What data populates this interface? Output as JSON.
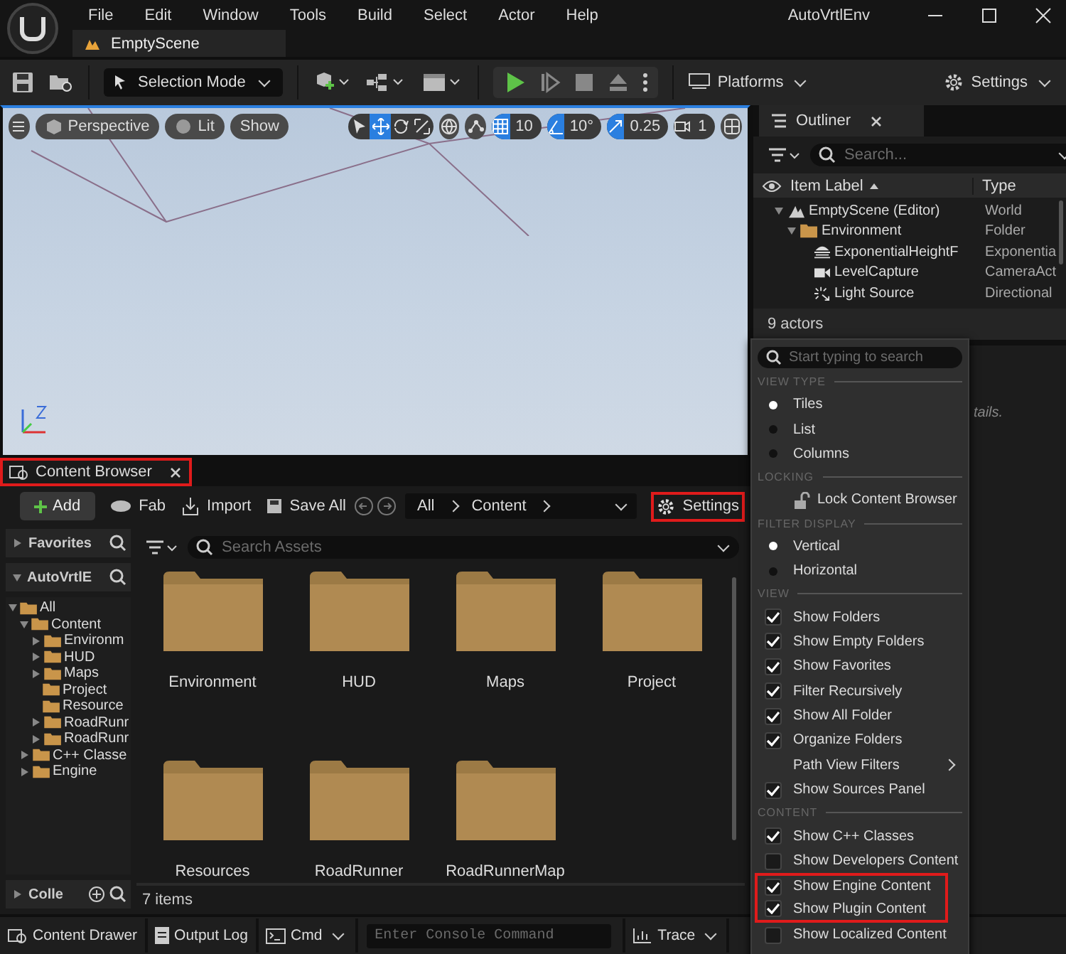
{
  "title_bar": {
    "menu": [
      "File",
      "Edit",
      "Window",
      "Tools",
      "Build",
      "Select",
      "Actor",
      "Help"
    ],
    "project": "AutoVrtlEnv",
    "tab": "EmptyScene"
  },
  "toolbar": {
    "mode": "Selection Mode",
    "platforms": "Platforms",
    "settings": "Settings"
  },
  "viewport": {
    "buttons": [
      {
        "kind": "view",
        "label": "Perspective"
      },
      {
        "kind": "lit",
        "label": "Lit"
      },
      {
        "kind": "plain",
        "label": "Show"
      }
    ],
    "tools": [
      {
        "kind": "select",
        "selected": false
      },
      {
        "kind": "move",
        "selected": true
      },
      {
        "kind": "rotate",
        "selected": false
      },
      {
        "kind": "scale",
        "selected": false
      }
    ],
    "snaps": [
      {
        "kind": "grid",
        "value": "10",
        "on": true
      },
      {
        "kind": "angle",
        "value": "10°",
        "on": true
      },
      {
        "kind": "scale",
        "value": "0.25",
        "on": true
      },
      {
        "kind": "camera",
        "value": "1",
        "on": false
      }
    ]
  },
  "outliner": {
    "title": "Outliner",
    "search": {
      "placeholder": "Search..."
    },
    "columns": [
      "Item Label",
      "Type"
    ],
    "rows": [
      {
        "label": "EmptyScene (Editor)",
        "type": "World",
        "kind": "world",
        "expanded": true,
        "children": [
          {
            "label": "Environment",
            "type": "Folder",
            "kind": "folder",
            "expanded": true,
            "children": [
              {
                "label": "ExponentialHeightF",
                "type": "Exponentia",
                "kind": "fog"
              },
              {
                "label": "LevelCapture",
                "type": "CameraAct",
                "kind": "camera"
              },
              {
                "label": "Light Source",
                "type": "Directional",
                "kind": "light"
              }
            ]
          }
        ]
      }
    ],
    "count": "9 actors"
  },
  "details": {
    "text": "tails."
  },
  "content_browser": {
    "tab": {
      "label": "Content Browser",
      "highlighted": true
    },
    "add": "Add",
    "fab": "Fab",
    "import": "Import",
    "save_all": "Save All",
    "path": [
      "All",
      "Content"
    ],
    "settings": {
      "label": "Settings",
      "highlighted": true
    },
    "sources": {
      "favorites": "Favorites",
      "project": "AutoVrtlE",
      "collections": "Colle",
      "tree": [
        {
          "label": "All",
          "expandable": true,
          "expanded": true,
          "children": [
            {
              "label": "Content",
              "expandable": true,
              "expanded": true,
              "children": [
                {
                  "label": "Environm",
                  "expandable": true,
                  "expanded": false
                },
                {
                  "label": "HUD",
                  "expandable": true,
                  "expanded": false
                },
                {
                  "label": "Maps",
                  "expandable": true,
                  "expanded": false
                },
                {
                  "label": "Project",
                  "expandable": false
                },
                {
                  "label": "Resource",
                  "expandable": false
                },
                {
                  "label": "RoadRunr",
                  "expandable": true,
                  "expanded": false
                },
                {
                  "label": "RoadRunr",
                  "expandable": true,
                  "expanded": false
                }
              ]
            },
            {
              "label": "C++ Classe",
              "expandable": true,
              "expanded": false
            },
            {
              "label": "Engine",
              "expandable": true,
              "expanded": false
            }
          ]
        }
      ]
    },
    "search": {
      "placeholder": "Search Assets"
    },
    "folders": [
      "Environment",
      "HUD",
      "Maps",
      "Project",
      "Resources",
      "RoadRunner",
      "RoadRunnerMap"
    ],
    "count": "7 items"
  },
  "settings_menu": {
    "search": {
      "placeholder": "Start typing to search"
    },
    "sections": [
      {
        "heading": "VIEW TYPE",
        "items": [
          {
            "kind": "radio",
            "label": "Tiles",
            "selected": true
          },
          {
            "kind": "radio",
            "label": "List",
            "selected": false
          },
          {
            "kind": "radio",
            "label": "Columns",
            "selected": false
          }
        ]
      },
      {
        "heading": "LOCKING",
        "items": [
          {
            "kind": "lock",
            "label": "Lock Content Browser"
          }
        ]
      },
      {
        "heading": "FILTER DISPLAY",
        "items": [
          {
            "kind": "radio",
            "label": "Vertical",
            "selected": true
          },
          {
            "kind": "radio",
            "label": "Horizontal",
            "selected": false
          }
        ]
      },
      {
        "heading": "VIEW",
        "items": [
          {
            "kind": "check",
            "label": "Show Folders",
            "checked": true
          },
          {
            "kind": "check",
            "label": "Show Empty Folders",
            "checked": true
          },
          {
            "kind": "check",
            "label": "Show Favorites",
            "checked": true
          },
          {
            "kind": "check",
            "label": "Filter Recursively",
            "checked": true
          },
          {
            "kind": "check",
            "label": "Show All Folder",
            "checked": true
          },
          {
            "kind": "check",
            "label": "Organize Folders",
            "checked": true
          },
          {
            "kind": "submenu",
            "label": "Path View Filters"
          },
          {
            "kind": "check",
            "label": "Show Sources Panel",
            "checked": true
          }
        ]
      },
      {
        "heading": "CONTENT",
        "items": [
          {
            "kind": "check",
            "label": "Show C++ Classes",
            "checked": true,
            "highlighted": false
          },
          {
            "kind": "check",
            "label": "Show Developers Content",
            "checked": false,
            "highlighted": false
          },
          {
            "kind": "check",
            "label": "Show Engine Content",
            "checked": true,
            "highlighted": true
          },
          {
            "kind": "check",
            "label": "Show Plugin Content",
            "checked": true,
            "highlighted": true
          },
          {
            "kind": "check",
            "label": "Show Localized Content",
            "checked": false,
            "highlighted": false
          }
        ]
      }
    ]
  },
  "status_bar": {
    "content_drawer": "Content Drawer",
    "output_log": "Output Log",
    "cmd": "Cmd",
    "console": {
      "placeholder": "Enter Console Command"
    },
    "trace": "Trace"
  }
}
